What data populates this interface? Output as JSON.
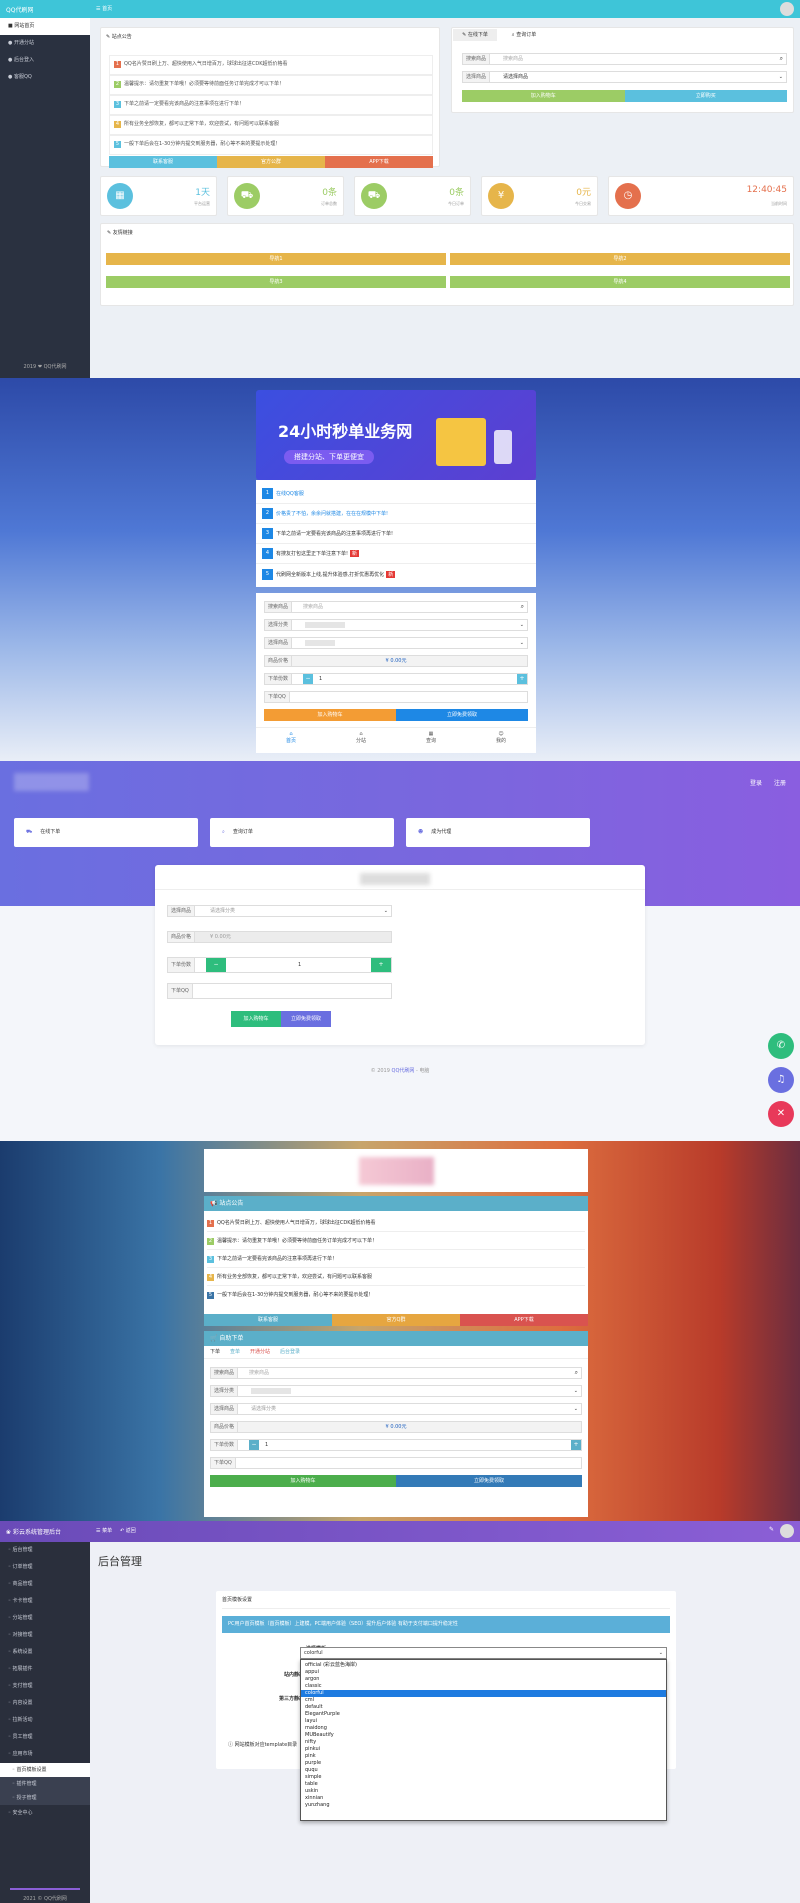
{
  "s1": {
    "logo": "QQ代刷网",
    "topnav_home": "首页",
    "sidebar": [
      "网站首页",
      "开通分站",
      "后台登入",
      "客服QQ"
    ],
    "sidebar_footer": "2019 ❤ QQ代刷网",
    "notice_title": "站点公告",
    "notices": [
      "QQ名片赞日刷上万、超快使用入气日增百万，球球出征进CDK超低价格看",
      "温馨提示：请勿重复下单哦！必须要等待前面任务订单完成才可以下单！",
      "下单之前请一定要看完该商品的注意事项在进行下单！",
      "所有业务全部恢复，都可以正常下单，欢迎尝试，有问题可以联系客服",
      "一般下单后会在1-30分钟内提交到服务器，耐心等不来的要提示处理！"
    ],
    "notice_buttons": [
      "联系客服",
      "官方公群",
      "APP下载"
    ],
    "tab_order": "在线下单",
    "tab_query": "查询订单",
    "search_label": "搜索商品",
    "search_placeholder": "搜索商品",
    "select_label": "选择商品",
    "select_value": "请选择商品",
    "btn_cart": "加入购物车",
    "btn_buy": "立即购买",
    "stats": [
      {
        "value": "1天",
        "label": "平台运营",
        "color": "#5bc0de"
      },
      {
        "value": "0条",
        "label": "订单总数",
        "color": "#9ccc65"
      },
      {
        "value": "0条",
        "label": "今日订单",
        "color": "#9ccc65"
      },
      {
        "value": "0元",
        "label": "今日交易",
        "color": "#e6b54a"
      },
      {
        "value": "12:40:45",
        "label": "当前时间",
        "color": "#e4704d"
      }
    ],
    "links_title": "友情链接",
    "links": [
      "导航1",
      "导航2",
      "导航3",
      "导航4"
    ]
  },
  "s2": {
    "banner_title": "24小时秒单业务网",
    "banner_sub": "搭建分站、下单更便宜",
    "notices": [
      {
        "n": "1",
        "t": "在线QQ客服",
        "c": "#1e88e5",
        "tag": ""
      },
      {
        "n": "2",
        "t": "价格贵了不怕，余余问就搭建，在在在规模中下单!",
        "c": "#1e88e5",
        "tag": ""
      },
      {
        "n": "3",
        "t": "下单之前请一定要看完该商品的注意事项再进行下单!",
        "c": "#1e88e5",
        "tag": ""
      },
      {
        "n": "4",
        "t": "有搜友打包这里正下单注意下单!",
        "c": "#1e88e5",
        "tag": "新"
      },
      {
        "n": "5",
        "t": "代刷网全新版本上线,提升体验感,打折优惠再优化",
        "c": "#1e88e5",
        "tag": "新"
      }
    ],
    "search_label": "搜索商品",
    "search_placeholder": "搜索商品",
    "cat_label": "选择分类",
    "goods_label": "选择商品",
    "price_label": "商品价格",
    "price_value": "¥ 0.00元",
    "qty_label": "下单份数",
    "qty_value": "1",
    "qq_label": "下单QQ",
    "btn_cart": "加入购物车",
    "btn_buy": "立即免费领取",
    "nav": [
      "首页",
      "分站",
      "查询",
      "我的"
    ]
  },
  "s3": {
    "login": "登录",
    "register": "注册",
    "cards": [
      "在线下单",
      "查询订单",
      "成为代理"
    ],
    "goods_label": "选择商品",
    "goods_value": "请选择分类",
    "price_label": "商品价格",
    "price_value": "¥ 0.00元",
    "qty_label": "下单份数",
    "qty_value": "1",
    "qq_label": "下单QQ",
    "btn_cart": "加入购物车",
    "btn_buy": "立即免费领取",
    "footer_prefix": "© 2019 ",
    "footer_link": "QQ代刷网",
    "footer_suffix": " - 电脑"
  },
  "s4": {
    "notice_title": "站点公告",
    "notices": [
      "QQ名片赞日刷上万、超快使用人气日增百万，球球出征CDK超低价格看",
      "温馨提示：请勿重复下单哦！必须要等待前面任务订单完成才可以下单！",
      "下单之前请一定要看完该商品的注意事项再进行下单！",
      "所有业务全部恢复，都可以正常下单，欢迎尝试，有问题可以联系客服",
      "一般下单后会在1-30分钟内提交到服务器，耐心等不来的要提示处理！"
    ],
    "notice_buttons": [
      "联系客服",
      "官方Q群",
      "APP下载"
    ],
    "order_title": "自助下单",
    "tabs": [
      "下单",
      "查单",
      "开通分站",
      "后台登录"
    ],
    "search_label": "搜索商品",
    "search_placeholder": "搜索商品",
    "cat_label": "选择分类",
    "goods_label": "选择商品",
    "goods_value": "请选择分类",
    "price_label": "商品价格",
    "price_value": "¥ 0.00元",
    "qty_label": "下单份数",
    "qty_value": "1",
    "qq_label": "下单QQ",
    "btn_cart": "加入购物车",
    "btn_buy": "立即免费领取"
  },
  "s5": {
    "app_title": "彩云系统管理后台",
    "top_menu": "菜单",
    "top_back": "返回",
    "page_title": "后台管理",
    "sidebar": [
      "后台管理",
      "订单管理",
      "商品管理",
      "卡卡管理",
      "分站管理",
      "对接管理",
      "系统设置",
      "拓展插件",
      "支付管理",
      "内容设置",
      "拉新活动",
      "员工管理",
      "应用市场",
      "首页模板设置",
      "插件管理",
      "授子管理",
      "安全中心"
    ],
    "sidebar_footer": "2021 © QQ代刷网",
    "card_title": "首页模板设置",
    "alert": "PC用户首页模板（首页模板）上建模，PC端用户体验（SEO）提升后户体验 有助于支付端口提升稳定性",
    "tpl_label": "选择模板",
    "tpl_value": "colorful",
    "cdn1_label": "站内静态资源CDN",
    "cdn2_label": "第三方静态资源CDN",
    "note": "网站模板对应template目录",
    "options": [
      "official (彩云蓝色海岸)",
      "appui",
      "argon",
      "classic",
      "colorful",
      "cml",
      "default",
      "ElegantPurple",
      "layui",
      "maidong",
      "MUBeautify",
      "nifty",
      "pinkui",
      "pink",
      "purple",
      "ququ",
      "simple",
      "table",
      "uskin",
      "xinnian",
      "yunzhang"
    ],
    "selected_index": 4
  }
}
